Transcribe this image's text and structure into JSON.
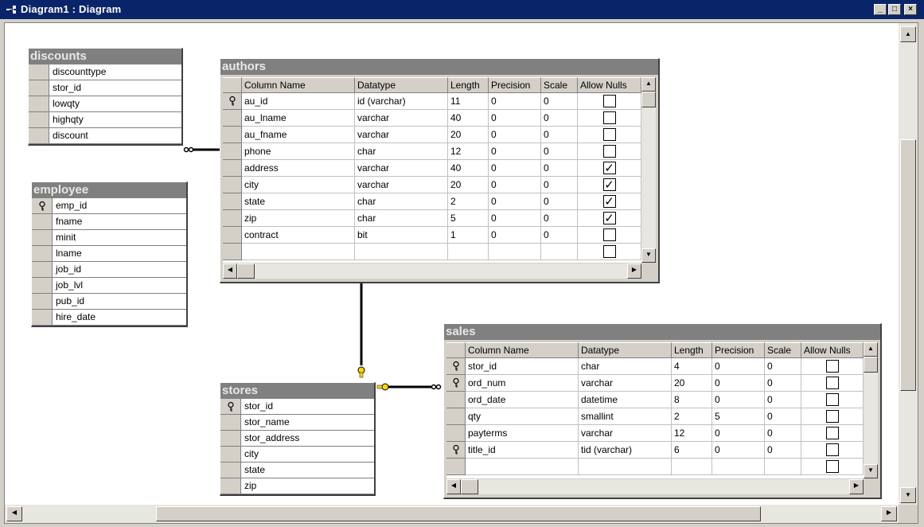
{
  "window": {
    "title": "Diagram1 : Diagram",
    "controls": {
      "minimize": "_",
      "maximize": "□",
      "close": "×"
    }
  },
  "tables": {
    "discounts": {
      "title": "discounts",
      "columns": [
        {
          "name": "discounttype",
          "key": false
        },
        {
          "name": "stor_id",
          "key": false
        },
        {
          "name": "lowqty",
          "key": false
        },
        {
          "name": "highqty",
          "key": false
        },
        {
          "name": "discount",
          "key": false
        }
      ]
    },
    "employee": {
      "title": "employee",
      "columns": [
        {
          "name": "emp_id",
          "key": true
        },
        {
          "name": "fname",
          "key": false
        },
        {
          "name": "minit",
          "key": false
        },
        {
          "name": "lname",
          "key": false
        },
        {
          "name": "job_id",
          "key": false
        },
        {
          "name": "job_lvl",
          "key": false
        },
        {
          "name": "pub_id",
          "key": false
        },
        {
          "name": "hire_date",
          "key": false
        }
      ]
    },
    "stores": {
      "title": "stores",
      "columns": [
        {
          "name": "stor_id",
          "key": true
        },
        {
          "name": "stor_name",
          "key": false
        },
        {
          "name": "stor_address",
          "key": false
        },
        {
          "name": "city",
          "key": false
        },
        {
          "name": "state",
          "key": false
        },
        {
          "name": "zip",
          "key": false
        }
      ]
    },
    "authors": {
      "title": "authors",
      "headers": [
        "Column Name",
        "Datatype",
        "Length",
        "Precision",
        "Scale",
        "Allow Nulls"
      ],
      "rows": [
        {
          "key": true,
          "name": "au_id",
          "type": "id (varchar)",
          "length": "11",
          "precision": "0",
          "scale": "0",
          "nulls": false
        },
        {
          "key": false,
          "name": "au_lname",
          "type": "varchar",
          "length": "40",
          "precision": "0",
          "scale": "0",
          "nulls": false
        },
        {
          "key": false,
          "name": "au_fname",
          "type": "varchar",
          "length": "20",
          "precision": "0",
          "scale": "0",
          "nulls": false
        },
        {
          "key": false,
          "name": "phone",
          "type": "char",
          "length": "12",
          "precision": "0",
          "scale": "0",
          "nulls": false
        },
        {
          "key": false,
          "name": "address",
          "type": "varchar",
          "length": "40",
          "precision": "0",
          "scale": "0",
          "nulls": true
        },
        {
          "key": false,
          "name": "city",
          "type": "varchar",
          "length": "20",
          "precision": "0",
          "scale": "0",
          "nulls": true
        },
        {
          "key": false,
          "name": "state",
          "type": "char",
          "length": "2",
          "precision": "0",
          "scale": "0",
          "nulls": true
        },
        {
          "key": false,
          "name": "zip",
          "type": "char",
          "length": "5",
          "precision": "0",
          "scale": "0",
          "nulls": true
        },
        {
          "key": false,
          "name": "contract",
          "type": "bit",
          "length": "1",
          "precision": "0",
          "scale": "0",
          "nulls": false
        },
        {
          "key": false,
          "name": "",
          "type": "",
          "length": "",
          "precision": "",
          "scale": "",
          "nulls": false
        }
      ]
    },
    "sales": {
      "title": "sales",
      "headers": [
        "Column Name",
        "Datatype",
        "Length",
        "Precision",
        "Scale",
        "Allow Nulls"
      ],
      "rows": [
        {
          "key": true,
          "name": "stor_id",
          "type": "char",
          "length": "4",
          "precision": "0",
          "scale": "0",
          "nulls": false
        },
        {
          "key": true,
          "name": "ord_num",
          "type": "varchar",
          "length": "20",
          "precision": "0",
          "scale": "0",
          "nulls": false
        },
        {
          "key": false,
          "name": "ord_date",
          "type": "datetime",
          "length": "8",
          "precision": "0",
          "scale": "0",
          "nulls": false
        },
        {
          "key": false,
          "name": "qty",
          "type": "smallint",
          "length": "2",
          "precision": "5",
          "scale": "0",
          "nulls": false
        },
        {
          "key": false,
          "name": "payterms",
          "type": "varchar",
          "length": "12",
          "precision": "0",
          "scale": "0",
          "nulls": false
        },
        {
          "key": true,
          "name": "title_id",
          "type": "tid (varchar)",
          "length": "6",
          "precision": "0",
          "scale": "0",
          "nulls": false
        },
        {
          "key": false,
          "name": "",
          "type": "",
          "length": "",
          "precision": "",
          "scale": "",
          "nulls": false
        }
      ]
    }
  },
  "colors": {
    "titlebar": "#0a246a",
    "table_title": "#808080",
    "relationship_line": "#000000",
    "key_marker": "#ffd700"
  }
}
